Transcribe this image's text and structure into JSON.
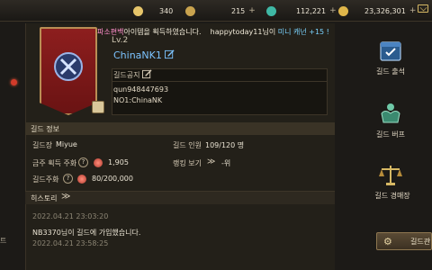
{
  "resources": [
    {
      "name": "crown-currency",
      "value": "340",
      "color": "#e6c56a",
      "plus": false
    },
    {
      "name": "euro-currency",
      "value": "215",
      "color": "#c9a34e",
      "plus": true
    },
    {
      "name": "gem-currency",
      "value": "112,221",
      "color": "#3fb8a5",
      "plus": true
    },
    {
      "name": "gold-currency",
      "value": "23,326,301",
      "color": "#e0b64a",
      "plus": true
    }
  ],
  "notice_ticker": {
    "prefix": "파소편백",
    "text": "아이템을 획득하였습니다.",
    "user": "happytoday11님이",
    "suffix": " 미니 캐넌 +15 !"
  },
  "guild": {
    "level": "Lv.2",
    "name": "ChinaNK1"
  },
  "notice": {
    "title": "길드공지",
    "line1": "qun948447693",
    "line2": "NO1:ChinaNK"
  },
  "info": {
    "header": "길드 정보",
    "leader_label": "길드장",
    "leader_value": "Miyue",
    "members_label": "길드 인원",
    "members_value": "109/120 명",
    "weekly_label": "금주 획득 주화",
    "weekly_value": "1,905",
    "ranking_label": "랭킹 보기",
    "ranking_value": "-위",
    "coin_label": "길드주화",
    "coin_value": "80/200,000"
  },
  "history": {
    "title": "히스토리",
    "entries": [
      {
        "date": "2022.04.21 23:03:20",
        "message": "NB3370님이 길드에 가입했습니다."
      },
      {
        "date": "2022.04.21 23:58:25",
        "message": ""
      }
    ]
  },
  "right_menu": {
    "attendance": "길드 출석",
    "buff": "길드 버프",
    "auction": "길드 경매장",
    "manage": "길드관"
  },
  "left_cut_text": "트"
}
